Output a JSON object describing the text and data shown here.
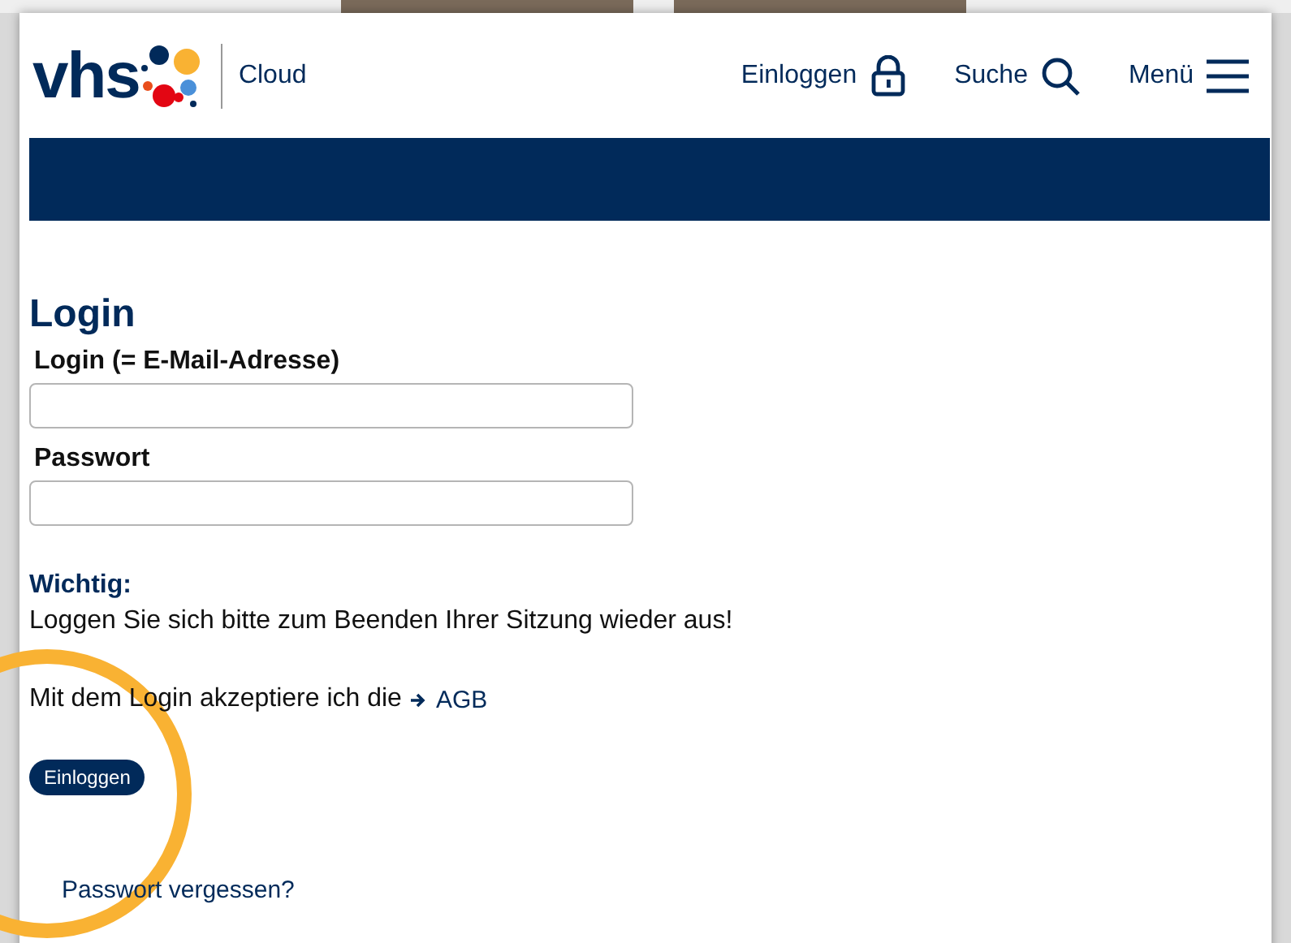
{
  "header": {
    "logo": "vhs",
    "product": "Cloud",
    "nav": [
      {
        "kind": "login",
        "label": "Einloggen"
      },
      {
        "kind": "search",
        "label": "Suche"
      },
      {
        "kind": "menu",
        "label": "Menü"
      }
    ]
  },
  "form": {
    "title": "Login",
    "fields": [
      {
        "label": "Login (= E-Mail-Adresse)"
      },
      {
        "label": "Passwort"
      }
    ],
    "notice_title": "Wichtig:",
    "notice": "Loggen Sie sich bitte zum Beenden Ihrer Sitzung wieder aus!",
    "terms": "Mit dem Login akzeptiere ich die",
    "terms_link": "AGB",
    "submit": "Einloggen",
    "forgot": "Passwort vergessen?"
  }
}
